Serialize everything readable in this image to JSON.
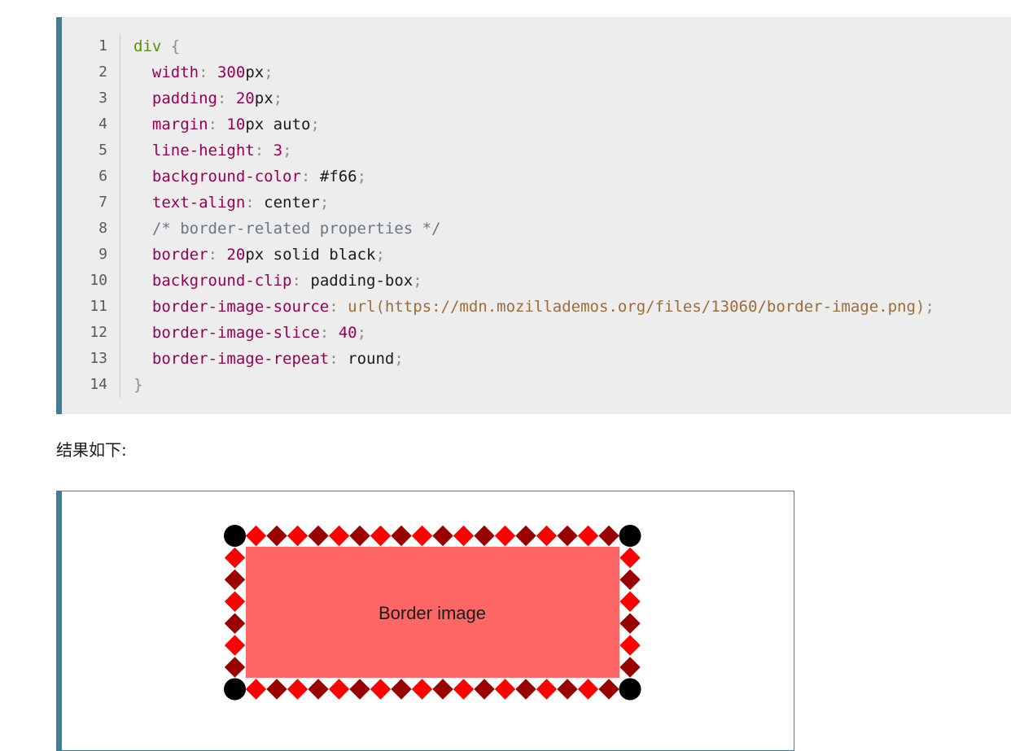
{
  "code_block": {
    "line_numbers": [
      "1",
      "2",
      "3",
      "4",
      "5",
      "6",
      "7",
      "8",
      "9",
      "10",
      "11",
      "12",
      "13",
      "14"
    ],
    "lines": [
      [
        {
          "t": "div",
          "c": "sel"
        },
        {
          "t": " {",
          "c": "punc"
        }
      ],
      [
        {
          "t": "  "
        },
        {
          "t": "width",
          "c": "prop"
        },
        {
          "t": ": ",
          "c": "punc"
        },
        {
          "t": "300",
          "c": "num"
        },
        {
          "t": "px",
          "c": "val"
        },
        {
          "t": ";",
          "c": "punc"
        }
      ],
      [
        {
          "t": "  "
        },
        {
          "t": "padding",
          "c": "prop"
        },
        {
          "t": ": ",
          "c": "punc"
        },
        {
          "t": "20",
          "c": "num"
        },
        {
          "t": "px",
          "c": "val"
        },
        {
          "t": ";",
          "c": "punc"
        }
      ],
      [
        {
          "t": "  "
        },
        {
          "t": "margin",
          "c": "prop"
        },
        {
          "t": ": ",
          "c": "punc"
        },
        {
          "t": "10",
          "c": "num"
        },
        {
          "t": "px auto",
          "c": "val"
        },
        {
          "t": ";",
          "c": "punc"
        }
      ],
      [
        {
          "t": "  "
        },
        {
          "t": "line-height",
          "c": "prop"
        },
        {
          "t": ": ",
          "c": "punc"
        },
        {
          "t": "3",
          "c": "num"
        },
        {
          "t": ";",
          "c": "punc"
        }
      ],
      [
        {
          "t": "  "
        },
        {
          "t": "background-color",
          "c": "prop"
        },
        {
          "t": ": ",
          "c": "punc"
        },
        {
          "t": "#f66",
          "c": "val"
        },
        {
          "t": ";",
          "c": "punc"
        }
      ],
      [
        {
          "t": "  "
        },
        {
          "t": "text-align",
          "c": "prop"
        },
        {
          "t": ": ",
          "c": "punc"
        },
        {
          "t": "center",
          "c": "val"
        },
        {
          "t": ";",
          "c": "punc"
        }
      ],
      [
        {
          "t": "  "
        },
        {
          "t": "/* border-related properties */",
          "c": "com"
        }
      ],
      [
        {
          "t": "  "
        },
        {
          "t": "border",
          "c": "prop"
        },
        {
          "t": ": ",
          "c": "punc"
        },
        {
          "t": "20",
          "c": "num"
        },
        {
          "t": "px solid black",
          "c": "val"
        },
        {
          "t": ";",
          "c": "punc"
        }
      ],
      [
        {
          "t": "  "
        },
        {
          "t": "background-clip",
          "c": "prop"
        },
        {
          "t": ": ",
          "c": "punc"
        },
        {
          "t": "padding-box",
          "c": "val"
        },
        {
          "t": ";",
          "c": "punc"
        }
      ],
      [
        {
          "t": "  "
        },
        {
          "t": "border-image-source",
          "c": "prop"
        },
        {
          "t": ": ",
          "c": "punc"
        },
        {
          "t": "url(https://mdn.mozillademos.org/files/13060/border-image.png)",
          "c": "url"
        },
        {
          "t": ";",
          "c": "punc"
        }
      ],
      [
        {
          "t": "  "
        },
        {
          "t": "border-image-slice",
          "c": "prop"
        },
        {
          "t": ": ",
          "c": "punc"
        },
        {
          "t": "40",
          "c": "num"
        },
        {
          "t": ";",
          "c": "punc"
        }
      ],
      [
        {
          "t": "  "
        },
        {
          "t": "border-image-repeat",
          "c": "prop"
        },
        {
          "t": ": ",
          "c": "punc"
        },
        {
          "t": "round",
          "c": "val"
        },
        {
          "t": ";",
          "c": "punc"
        }
      ],
      [
        {
          "t": "}",
          "c": "punc"
        }
      ]
    ]
  },
  "caption": "结果如下:",
  "result": {
    "demo_text": "Border image",
    "fill_color": "#ff6666",
    "diamond_color_light": "#ff0000",
    "diamond_color_dark": "#990000",
    "corner_color": "#000000"
  },
  "colors": {
    "accent": "#3f7e98",
    "code_background": "#ededed"
  }
}
